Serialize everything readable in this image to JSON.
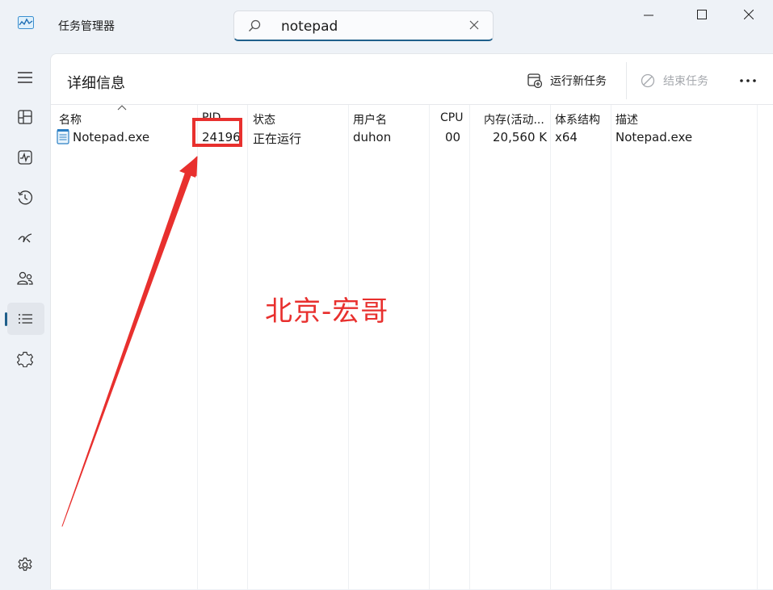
{
  "window": {
    "title": "任务管理器",
    "search_value": "notepad"
  },
  "sidebar": {
    "items": [
      {
        "name": "hamburger-menu-icon"
      },
      {
        "name": "processes-icon"
      },
      {
        "name": "performance-icon"
      },
      {
        "name": "app-history-icon"
      },
      {
        "name": "startup-apps-icon"
      },
      {
        "name": "users-icon"
      },
      {
        "name": "details-icon",
        "active": true
      },
      {
        "name": "services-icon"
      },
      {
        "name": "settings-icon"
      }
    ]
  },
  "page": {
    "title": "详细信息"
  },
  "toolbar": {
    "run_new_task": "运行新任务",
    "end_task": "结束任务"
  },
  "table": {
    "columns": [
      "名称",
      "PID",
      "状态",
      "用户名",
      "CPU",
      "内存(活动...",
      "体系结构",
      "描述"
    ],
    "rows": [
      {
        "name": "Notepad.exe",
        "pid": "24196",
        "status": "正在运行",
        "user": "duhon",
        "cpu": "00",
        "memory": "20,560 K",
        "arch": "x64",
        "description": "Notepad.exe"
      }
    ]
  },
  "annotation": {
    "watermark": "北京-宏哥",
    "color": "#e8302e"
  }
}
